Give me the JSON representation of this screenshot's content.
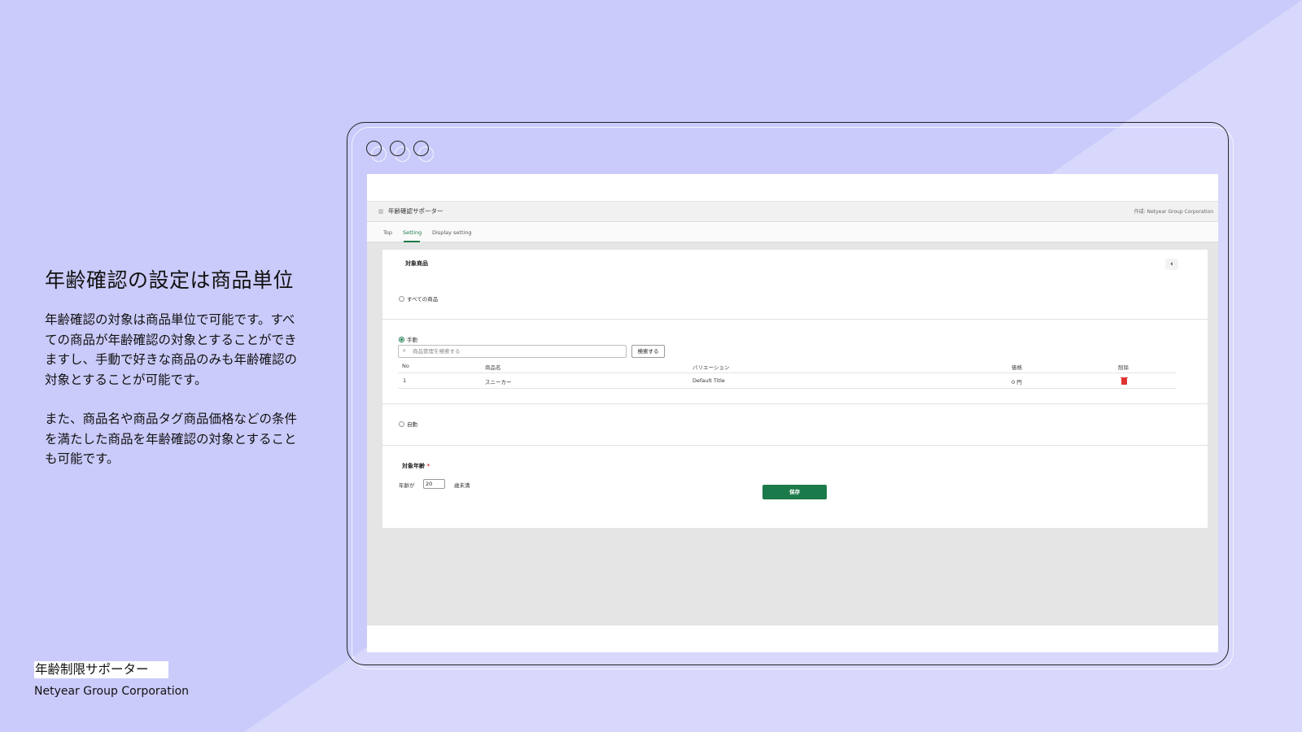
{
  "slide": {
    "headline": "年齢確認の設定は商品単位",
    "paragraph1": "年齢確認の対象は商品単位で可能です。すべての商品が年齢確認の対象とすることができますし、手動で好きな商品のみも年齢確認の対象とすることが可能です。",
    "paragraph2": "また、商品名や商品タグ商品価格などの条件を満たした商品を年齢確認の対象とすることも可能です。",
    "brand_name": "年齢制限サポーター",
    "company": "Netyear Group Corporation"
  },
  "app": {
    "title": "年齢確認サポーター",
    "creator": "作成: Netyear Group Corporation",
    "tabs": [
      "Top",
      "Setting",
      "Display setting"
    ],
    "active_tab": "Setting",
    "target_products": {
      "title": "対象商品",
      "collapse_symbol": "‹",
      "option_all": "すべての商品",
      "option_manual": "手動",
      "option_auto": "自動",
      "selected_option": "手動",
      "search_placeholder": "商品管理を検索する",
      "search_button": "検索する",
      "table": {
        "headers": [
          "No",
          "商品名",
          "バリエーション",
          "価格",
          "削除"
        ],
        "rows": [
          {
            "no": "1",
            "name": "スニーカー",
            "variation": "Default Title",
            "price": "0 円"
          }
        ]
      }
    },
    "target_age": {
      "title": "対象年齢",
      "required_mark": "*",
      "prefix": "年齢が",
      "value": "20",
      "suffix": "歳未満"
    },
    "save_button": "保存"
  },
  "colors": {
    "background": "#cbcbfb",
    "accent_green": "#1b7a4a",
    "delete_red": "#e03131"
  }
}
